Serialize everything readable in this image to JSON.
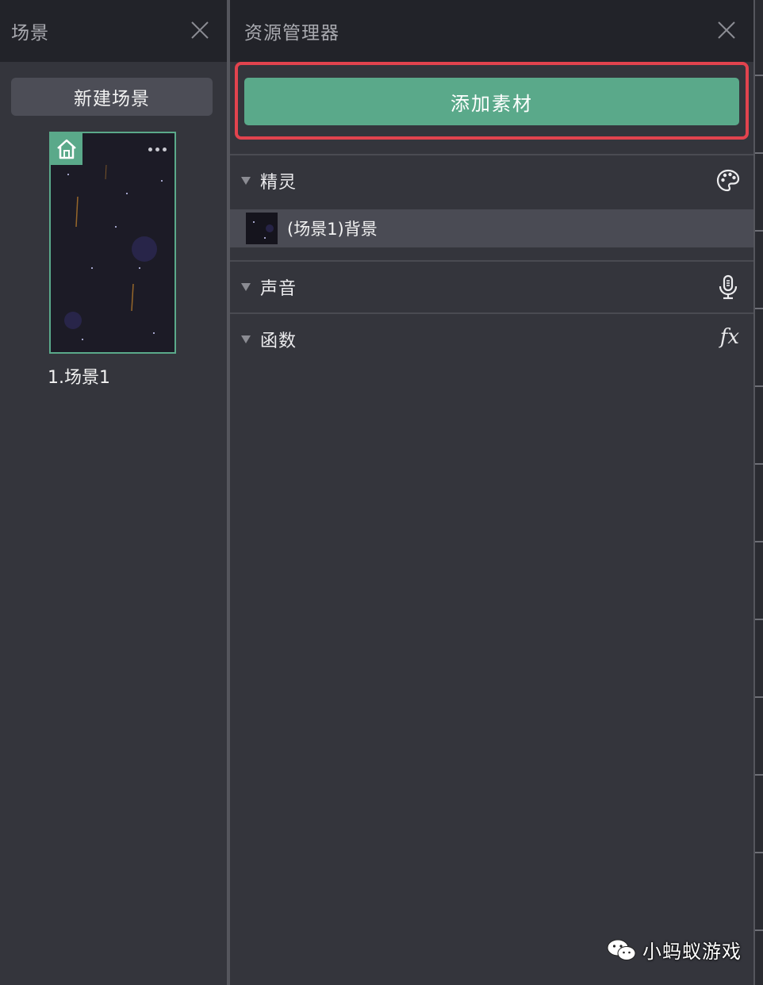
{
  "scene_panel": {
    "title": "场景",
    "new_scene_label": "新建场景",
    "scenes": [
      {
        "label": "1.场景1"
      }
    ]
  },
  "asset_panel": {
    "title": "资源管理器",
    "add_asset_label": "添加素材",
    "sections": {
      "sprite": {
        "label": "精灵",
        "icon": "palette-icon"
      },
      "sound": {
        "label": "声音",
        "icon": "microphone-icon"
      },
      "function": {
        "label": "函数",
        "icon": "fx-icon",
        "icon_text": "fx"
      }
    },
    "sprites": [
      {
        "name": "(场景1)背景"
      }
    ]
  },
  "watermark": {
    "text": "小蚂蚁游戏",
    "icon": "wechat-icon"
  },
  "colors": {
    "accent_green": "#5aa98a",
    "highlight_red": "#e2434e",
    "header_bg": "#222329",
    "panel_bg": "#34353c"
  }
}
